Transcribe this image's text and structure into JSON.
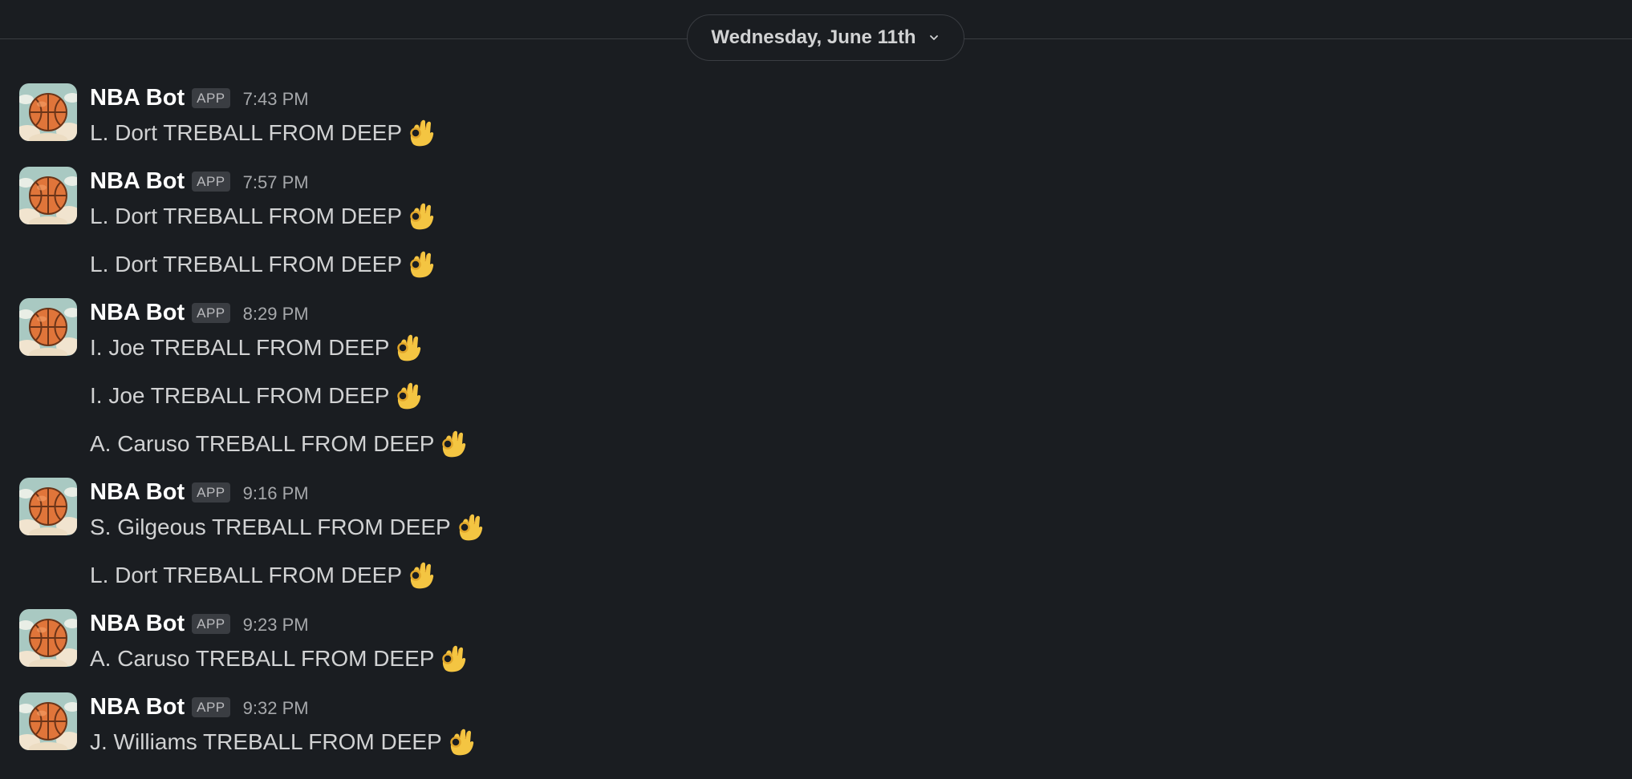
{
  "date_divider": {
    "label": "Wednesday, June 11th"
  },
  "icons": {
    "chevron": "chevron-down-icon",
    "emoji": "ok-hand-emoji",
    "avatar": "basketball-avatar"
  },
  "colors": {
    "background": "#1a1d21",
    "text": "#d1d2d3",
    "sender": "#ffffff",
    "muted": "#a6a8ab",
    "badge_bg": "#3a3d42"
  },
  "messages": [
    {
      "sender": "NBA Bot",
      "badge": "APP",
      "time": "7:43 PM",
      "lines": [
        "L. Dort TREBALL FROM DEEP"
      ]
    },
    {
      "sender": "NBA Bot",
      "badge": "APP",
      "time": "7:57 PM",
      "lines": [
        "L. Dort TREBALL FROM DEEP",
        "L. Dort TREBALL FROM DEEP"
      ]
    },
    {
      "sender": "NBA Bot",
      "badge": "APP",
      "time": "8:29 PM",
      "lines": [
        "I. Joe TREBALL FROM DEEP",
        "I. Joe TREBALL FROM DEEP",
        "A. Caruso TREBALL FROM DEEP"
      ]
    },
    {
      "sender": "NBA Bot",
      "badge": "APP",
      "time": "9:16 PM",
      "lines": [
        "S. Gilgeous TREBALL FROM DEEP",
        "L. Dort TREBALL FROM DEEP"
      ]
    },
    {
      "sender": "NBA Bot",
      "badge": "APP",
      "time": "9:23 PM",
      "lines": [
        "A. Caruso TREBALL FROM DEEP"
      ]
    },
    {
      "sender": "NBA Bot",
      "badge": "APP",
      "time": "9:32 PM",
      "lines": [
        "J. Williams TREBALL FROM DEEP"
      ]
    }
  ]
}
